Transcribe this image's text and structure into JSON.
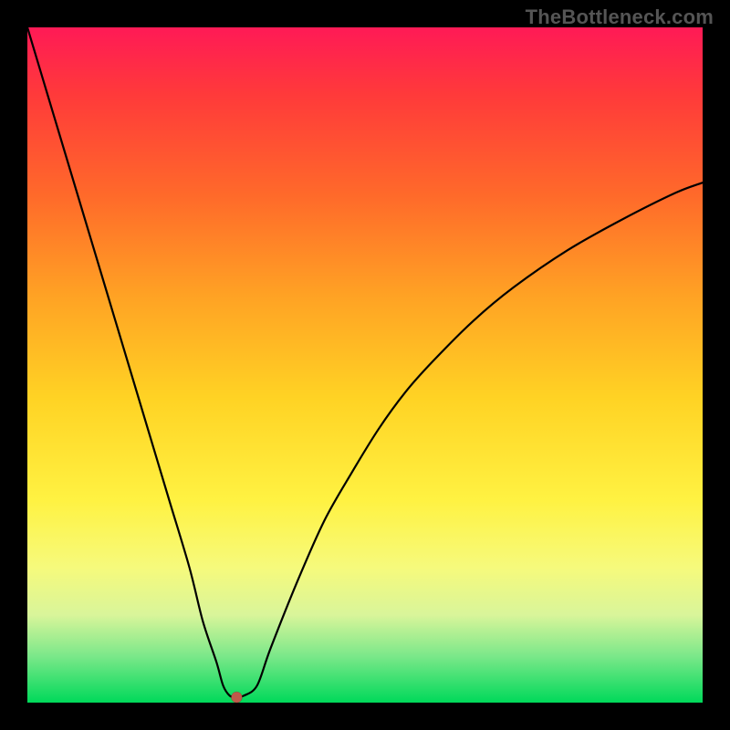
{
  "watermark": "TheBottleneck.com",
  "colors": {
    "page_bg": "#000000",
    "gradient_top": "#ff1a56",
    "gradient_bottom": "#00d95a",
    "curve": "#000000",
    "marker": "#bf5a4a"
  },
  "chart_data": {
    "type": "line",
    "title": "",
    "xlabel": "",
    "ylabel": "",
    "xlim": [
      0,
      100
    ],
    "ylim": [
      0,
      100
    ],
    "x": [
      0,
      3,
      6,
      9,
      12,
      15,
      18,
      21,
      24,
      26,
      28,
      29,
      30,
      31,
      32,
      34,
      36,
      40,
      44,
      48,
      52,
      56,
      60,
      66,
      72,
      80,
      88,
      96,
      100
    ],
    "values": [
      100,
      90,
      80,
      70,
      60,
      50,
      40,
      30,
      20,
      12,
      6,
      2.5,
      1,
      0.8,
      1,
      2.5,
      8,
      18,
      27,
      34,
      40.5,
      46,
      50.5,
      56.5,
      61.5,
      67,
      71.5,
      75.5,
      77
    ],
    "minimum_marker": {
      "x": 31,
      "y": 0.8
    },
    "grid": false,
    "legend": false,
    "annotations": []
  }
}
